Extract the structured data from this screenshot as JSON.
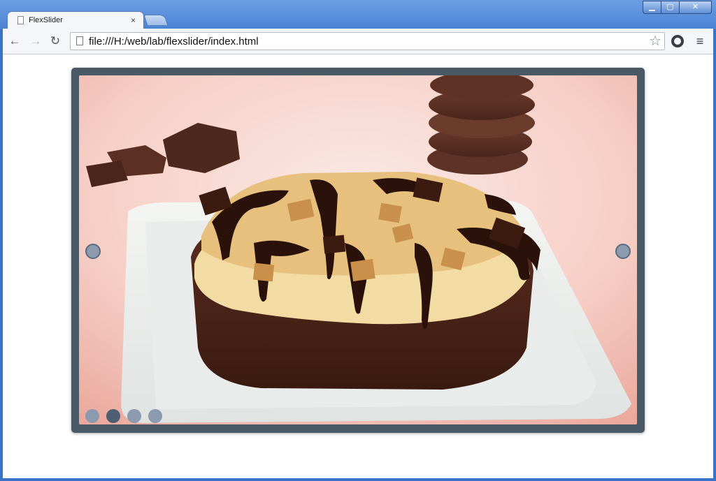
{
  "browser": {
    "tab": {
      "title": "FlexSlider",
      "close_glyph": "×",
      "icon": "page-icon"
    },
    "new_tab_icon": "new-tab-icon",
    "window_controls": {
      "minimize": "▁",
      "maximize": "▢",
      "close": "✕"
    },
    "nav": {
      "back": "←",
      "forward": "→",
      "reload": "↻"
    },
    "address": {
      "url": "file:///H:/web/lab/flexslider/index.html",
      "icon": "page-icon"
    },
    "star_glyph": "☆",
    "menu_glyph": "≡"
  },
  "slider": {
    "image_description_icon": "cake-photo",
    "page_count": 4,
    "active_index": 1,
    "colors": {
      "frame": "#4a5966",
      "dot": "#8b9aae",
      "dot_active": "#4e5f73"
    }
  }
}
